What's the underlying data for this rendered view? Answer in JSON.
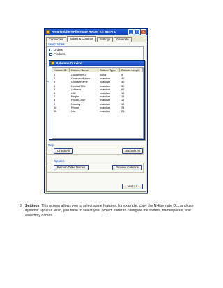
{
  "window": {
    "title": "Area Mobile NHibernate Helper Kit BETA 1",
    "controls": [
      "_",
      "□",
      "×"
    ]
  },
  "tabs": [
    {
      "label": "Connection"
    },
    {
      "label": "Tables & Columns",
      "active": true
    },
    {
      "label": "Settings"
    },
    {
      "label": "Generate"
    }
  ],
  "select_tables": {
    "label": "Select tables",
    "items": [
      {
        "label": "Orders",
        "checked": true
      },
      {
        "label": "Products",
        "checked": false
      }
    ]
  },
  "columns_preview": {
    "title": "Columns Preview",
    "headers": [
      "Column ID",
      "Column Name",
      "Column Type",
      "Column Length"
    ],
    "rows": [
      [
        "1",
        "CustomerID",
        "nchar",
        "5"
      ],
      [
        "2",
        "CompanyName",
        "nvarchar",
        "40"
      ],
      [
        "3",
        "ContactName",
        "nvarchar",
        "30"
      ],
      [
        "4",
        "ContactTitle",
        "nvarchar",
        "30"
      ],
      [
        "5",
        "Address",
        "nvarchar",
        "60"
      ],
      [
        "6",
        "City",
        "nvarchar",
        "15"
      ],
      [
        "7",
        "Region",
        "nvarchar",
        "15"
      ],
      [
        "8",
        "PostalCode",
        "nvarchar",
        "10"
      ],
      [
        "9",
        "Country",
        "nvarchar",
        "15"
      ],
      [
        "10",
        "Phone",
        "nvarchar",
        "24"
      ],
      [
        "11",
        "Fax",
        "nvarchar",
        "24"
      ]
    ]
  },
  "help": {
    "label": "Help",
    "check_all": "Check All",
    "uncheck_all": "Uncheck All"
  },
  "options": {
    "label": "Options",
    "refresh": "Refresh Table Names",
    "preview": "Preview Columns"
  },
  "next_button": "Next >>",
  "caption": {
    "number": "3.",
    "bold": "Settings",
    "text": ": This screen allows you to select some features, for example, copy the NHibernate DLL and use dynamic updates. Also, you have to select your project folder to configure the folders, namespaces, and assembly names."
  },
  "colors": {
    "title_bar": "#0b3fb0",
    "group_label": "#0046d5",
    "window_bg": "#ece9d8"
  }
}
